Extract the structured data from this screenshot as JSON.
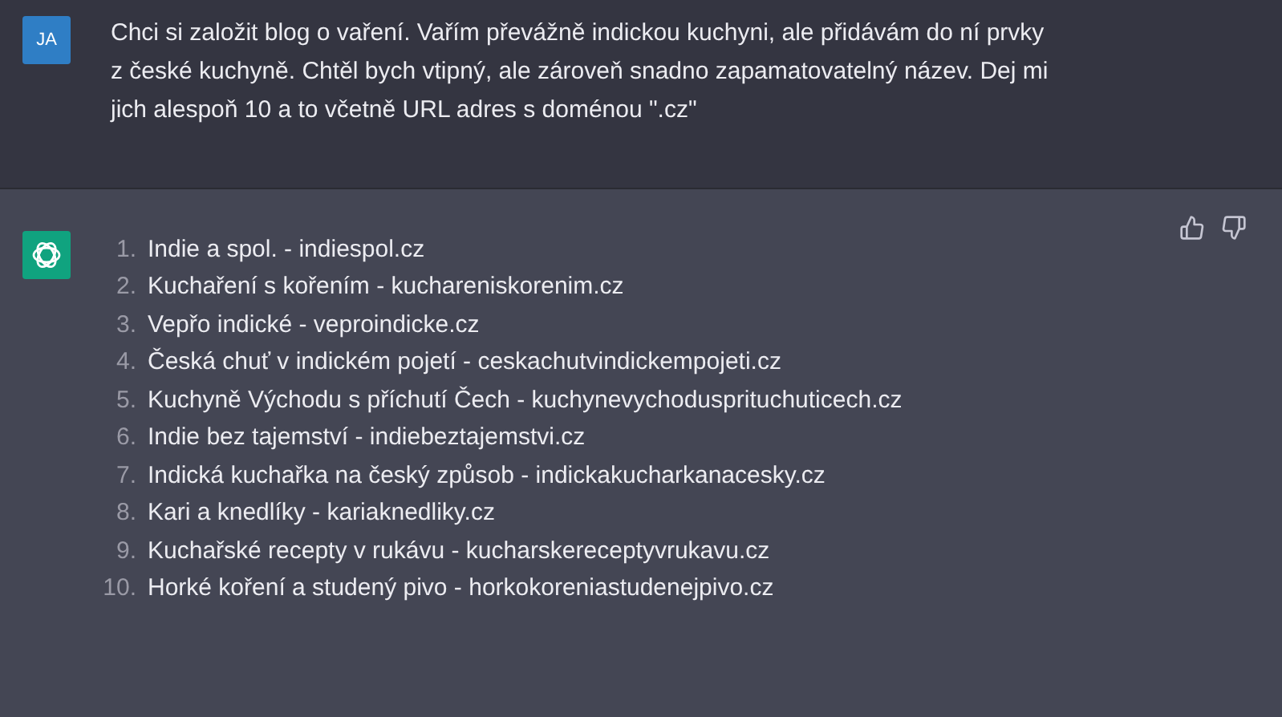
{
  "user_message": {
    "avatar": "JA",
    "text": "Chci si založit blog o vaření. Vařím převážně indickou kuchyni, ale přidávám do ní prvky z české kuchyně. Chtěl bych vtipný, ale zároveň snadno zapamatovatelný název. Dej mi jich alespoň 10 a to včetně URL adres s doménou \".cz\""
  },
  "assistant_message": {
    "items": [
      {
        "number": "1.",
        "text": "Indie a spol. - indiespol.cz"
      },
      {
        "number": "2.",
        "text": "Kuchaření s kořením - kuchareniskorenim.cz"
      },
      {
        "number": "3.",
        "text": "Vepřo indické - veproindicke.cz"
      },
      {
        "number": "4.",
        "text": "Česká chuť v indickém pojetí - ceskachutvindickempojeti.cz"
      },
      {
        "number": "5.",
        "text": "Kuchyně Východu s příchutí Čech - kuchynevychodusprituchuticech.cz"
      },
      {
        "number": "6.",
        "text": "Indie bez tajemství - indiebeztajemstvi.cz"
      },
      {
        "number": "7.",
        "text": "Indická kuchařka na český způsob - indickakucharkanacesky.cz"
      },
      {
        "number": "8.",
        "text": "Kari a knedlíky - kariaknedliky.cz"
      },
      {
        "number": "9.",
        "text": "Kuchařské recepty v rukávu - kucharskereceptyvrukavu.cz"
      },
      {
        "number": "10.",
        "text": "Horké koření a studený pivo - horkokoreniastudenejpivo.cz"
      }
    ]
  }
}
